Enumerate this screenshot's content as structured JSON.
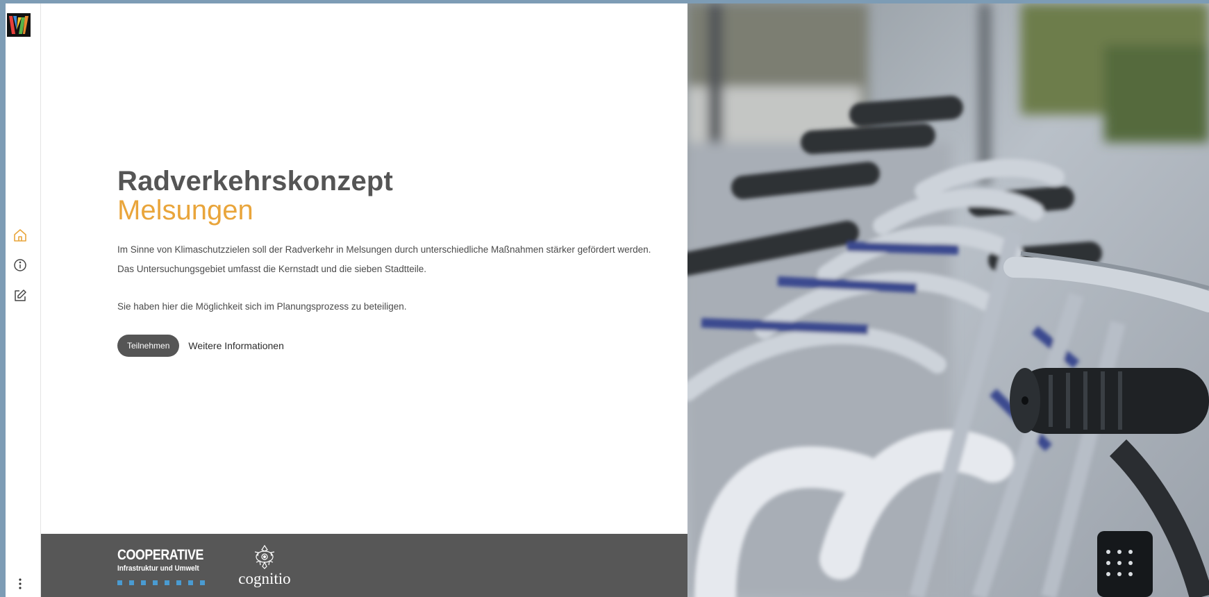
{
  "sidebar": {
    "logo": "app-logo",
    "nav": [
      {
        "icon": "home-icon",
        "label": "Home",
        "active": true
      },
      {
        "icon": "info-icon",
        "label": "Info",
        "active": false
      },
      {
        "icon": "edit-icon",
        "label": "Edit",
        "active": false
      }
    ],
    "more_icon": "more-vertical-icon"
  },
  "hero": {
    "title_line1": "Radverkehrskonzept",
    "title_line2": "Melsungen",
    "paragraph1_line1": "Im Sinne von Klimaschutzzielen soll der Radverkehr in Melsungen durch unterschiedliche Maßnahmen stärker gefördert werden.",
    "paragraph1_line2": "Das Untersuchungsgebiet umfasst die Kernstadt und die sieben Stadtteile.",
    "paragraph2": "Sie haben hier die Möglichkeit sich im Planungsprozess zu beteiligen.",
    "primary_button": "Teilnehmen",
    "secondary_link": "Weitere Informationen"
  },
  "footer": {
    "partner1_title": "COOPERATIVE",
    "partner1_subtitle": "Infrastruktur und Umwelt",
    "partner2_name": "cognitio"
  },
  "colors": {
    "accent": "#e9a53b",
    "title": "#555555",
    "footer_bg": "#575757",
    "button_bg": "#555555",
    "page_frame": "#7d9cb5"
  }
}
